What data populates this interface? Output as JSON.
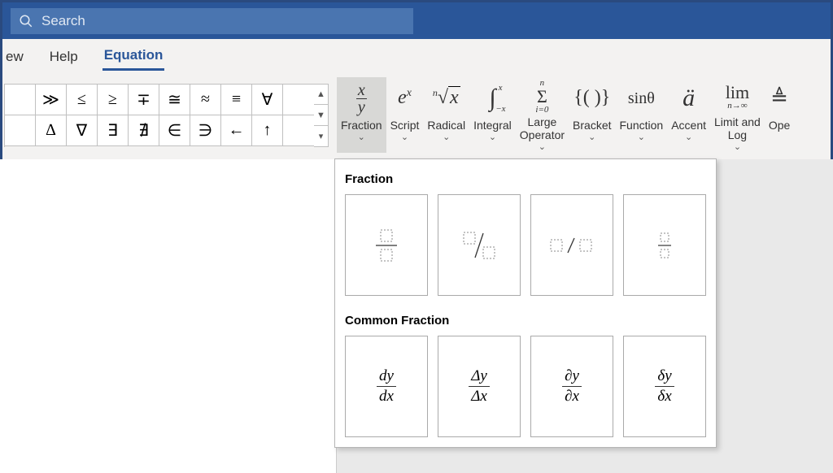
{
  "search": {
    "placeholder": "Search"
  },
  "tabs": [
    "ew",
    "Help",
    "Equation"
  ],
  "active_tab": "Equation",
  "symbols_row1": [
    "",
    "≫",
    "≤",
    "≥",
    "∓",
    "≅",
    "≈",
    "≡",
    "∀"
  ],
  "symbols_row2": [
    "",
    "∆",
    "∇",
    "∃",
    "∄",
    "∈",
    "∋",
    "←",
    "↑"
  ],
  "structures": [
    {
      "label": "Fraction",
      "name": "fraction"
    },
    {
      "label": "Script",
      "name": "script"
    },
    {
      "label": "Radical",
      "name": "radical"
    },
    {
      "label": "Integral",
      "name": "integral"
    },
    {
      "label": "Large\nOperator",
      "name": "large-operator"
    },
    {
      "label": "Bracket",
      "name": "bracket"
    },
    {
      "label": "Function",
      "name": "function"
    },
    {
      "label": "Accent",
      "name": "accent"
    },
    {
      "label": "Limit and\nLog",
      "name": "limit-log"
    },
    {
      "label": "Ope",
      "name": "operator"
    }
  ],
  "dropdown": {
    "section1": "Fraction",
    "section2": "Common Fraction",
    "common": [
      {
        "num": "dy",
        "den": "dx"
      },
      {
        "num": "Δy",
        "den": "Δx"
      },
      {
        "num": "∂y",
        "den": "∂x"
      },
      {
        "num": "δy",
        "den": "δx"
      }
    ]
  }
}
